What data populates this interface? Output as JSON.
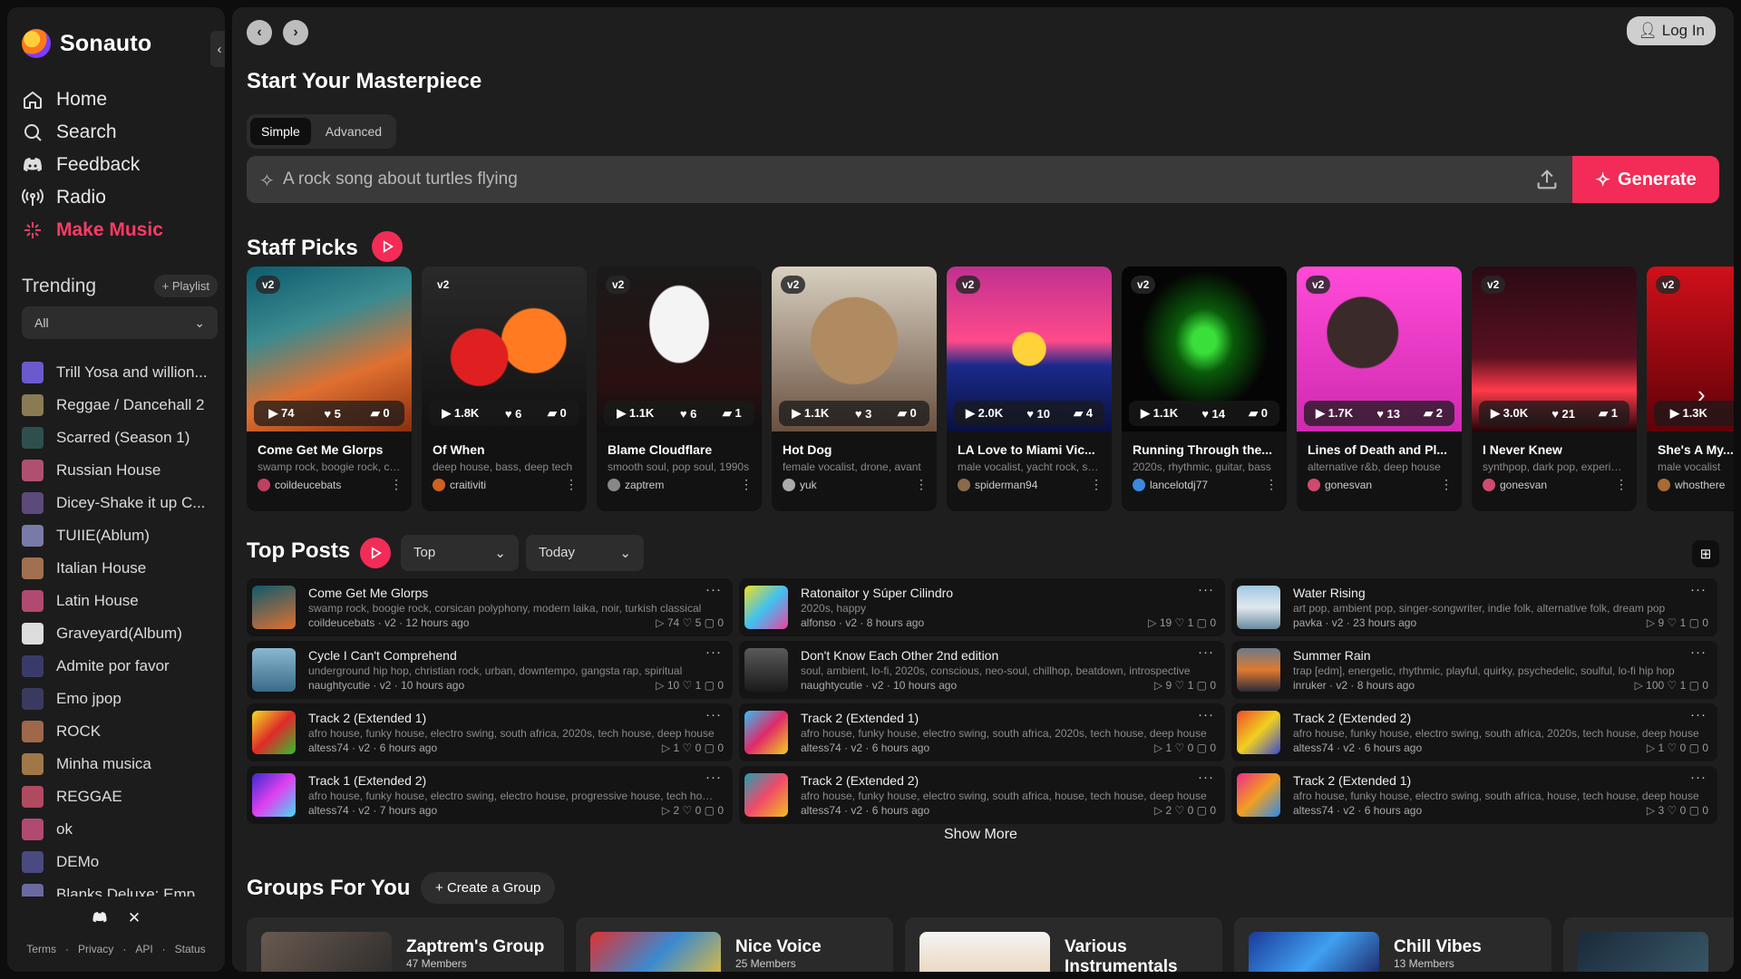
{
  "app": {
    "name": "Sonauto",
    "login_label": "Log In"
  },
  "nav": [
    {
      "label": "Home",
      "icon": "home-icon",
      "active": false
    },
    {
      "label": "Search",
      "icon": "search-icon",
      "active": false
    },
    {
      "label": "Feedback",
      "icon": "discord-icon",
      "active": false
    },
    {
      "label": "Radio",
      "icon": "radio-icon",
      "active": false
    },
    {
      "label": "Make Music",
      "icon": "sparkle-icon",
      "active": true
    }
  ],
  "trending": {
    "title": "Trending",
    "playlist_label": "Playlist",
    "filter_value": "All",
    "items": [
      {
        "label": "Trill Yosa and willion...",
        "color": "#6a5acd"
      },
      {
        "label": "Reggae / Dancehall 2",
        "color": "#8b7b55"
      },
      {
        "label": "Scarred (Season 1)",
        "color": "#2f4f4f"
      },
      {
        "label": "Russian House",
        "color": "#b05070"
      },
      {
        "label": "Dicey-Shake it up C...",
        "color": "#5b4a7a"
      },
      {
        "label": "TUIIE(Ablum)",
        "color": "#7a7aa8"
      },
      {
        "label": "Italian House",
        "color": "#a07050"
      },
      {
        "label": "Latin House",
        "color": "#b04a70"
      },
      {
        "label": "Graveyard(Album)",
        "color": "#dddddd"
      },
      {
        "label": "Admite por favor",
        "color": "#3a3a6a"
      },
      {
        "label": "Emo jpop",
        "color": "#3a3a60"
      },
      {
        "label": "ROCK",
        "color": "#a0684a"
      },
      {
        "label": "Minha musica",
        "color": "#a07848"
      },
      {
        "label": "REGGAE",
        "color": "#b04a60"
      },
      {
        "label": "ok",
        "color": "#b04a70"
      },
      {
        "label": "DEMo",
        "color": "#4a4a80"
      },
      {
        "label": "Blanks Deluxe: Emp",
        "color": "#6a6aa0"
      }
    ]
  },
  "footer": {
    "links": [
      "Terms",
      "Privacy",
      "API",
      "Status"
    ],
    "social": [
      "discord-icon",
      "x-icon"
    ]
  },
  "create": {
    "title": "Start Your Masterpiece",
    "tabs": [
      "Simple",
      "Advanced"
    ],
    "active_tab": "Simple",
    "placeholder": "A rock song about turtles flying",
    "generate_label": "Generate"
  },
  "staff_picks": {
    "title": "Staff Picks",
    "badge": "v2",
    "cards": [
      {
        "title": "Come Get Me Glorps",
        "tags": "swamp rock, boogie rock, corsican polyphony",
        "user": "coildeucebats",
        "plays": "74",
        "likes": "5",
        "comments": "0",
        "art": "linear-gradient(160deg,#0e5b6e 0%,#3a8a8f 35%,#e07030 65%,#8a2e10 100%)",
        "avatar": "#c04060"
      },
      {
        "title": "Of When",
        "tags": "deep house, bass, deep tech",
        "user": "craitiviti",
        "plays": "1.8K",
        "likes": "6",
        "comments": "0",
        "art": "radial-gradient(circle at 35% 55%,#e02020 0 20%,transparent 21%),radial-gradient(circle at 68% 45%,#ff7a20 0 22%,transparent 23%),linear-gradient(180deg,#2a2a2a,#111)",
        "avatar": "#d06020"
      },
      {
        "title": "Blame Cloudflare",
        "tags": "smooth soul, pop soul, 1990s",
        "user": "zaptrem",
        "plays": "1.1K",
        "likes": "6",
        "comments": "1",
        "art": "radial-gradient(ellipse at 50% 35%,#f4f4f4 0 25%,transparent 26%),linear-gradient(180deg,#1a1a1a,#2a1010 70%,#101010)",
        "avatar": "#888888"
      },
      {
        "title": "Hot Dog",
        "tags": "female vocalist, drone, avant",
        "user": "yuk",
        "plays": "1.1K",
        "likes": "3",
        "comments": "0",
        "art": "radial-gradient(circle at 50% 45%,#b08a60 0 35%,transparent 36%),linear-gradient(180deg,#d8d0c0,#6a5040)",
        "avatar": "#aaaaaa"
      },
      {
        "title": "LA Love to Miami Vic...",
        "tags": "male vocalist, yacht rock, synth",
        "user": "spiderman94",
        "plays": "2.0K",
        "likes": "10",
        "comments": "4",
        "art": "radial-gradient(circle at 50% 50%,#ffd23a 0 14%,transparent 15%),linear-gradient(180deg,#c03090 0%,#ff4a8a 45%,#1a2a8a 60%,#0a1040 100%)",
        "avatar": "#8a6a4a"
      },
      {
        "title": "Running Through the...",
        "tags": "2020s, rhythmic, guitar, bass",
        "user": "lancelotdj77",
        "plays": "1.1K",
        "likes": "14",
        "comments": "0",
        "art": "radial-gradient(ellipse at 50% 45%,#3adf3a 0 10%,#0a5a0a 25%,#050505 55%)",
        "avatar": "#3a8adf"
      },
      {
        "title": "Lines of Death and Pl...",
        "tags": "alternative r&b, deep house",
        "user": "gonesvan",
        "plays": "1.7K",
        "likes": "13",
        "comments": "2",
        "art": "radial-gradient(circle at 40% 40%,#3a2a2a 0 25%,transparent 26%),linear-gradient(180deg,#ff4ad8,#d02ab0)",
        "avatar": "#d04a70"
      },
      {
        "title": "I Never Knew",
        "tags": "synthpop, dark pop, experimental",
        "user": "gonesvan",
        "plays": "3.0K",
        "likes": "21",
        "comments": "1",
        "art": "linear-gradient(180deg,#2a0a14 0%,#5a1020 55%,#ff3a4a 75%,#200408 100%)",
        "avatar": "#d04a70"
      },
      {
        "title": "She's A My...",
        "tags": "male vocalist",
        "user": "whosthere",
        "plays": "1.3K",
        "likes": "",
        "comments": "",
        "art": "linear-gradient(180deg,#d0101a,#600008)",
        "avatar": "#aa6a30"
      }
    ]
  },
  "top_posts": {
    "title": "Top Posts",
    "sort_value": "Top",
    "range_value": "Today",
    "show_more_label": "Show More",
    "posts": [
      {
        "title": "Come Get Me Glorps",
        "tags": "swamp rock, boogie rock, corsican polyphony, modern laika, noir, turkish classical",
        "user": "coildeucebats",
        "version": "v2",
        "time": "12 hours ago",
        "plays": "74",
        "likes": "5",
        "comments": "0",
        "art": "linear-gradient(160deg,#0e5b6e,#e07030)"
      },
      {
        "title": "Ratonaitor y Súper Cilindro",
        "tags": "2020s, happy",
        "user": "alfonso",
        "version": "v2",
        "time": "8 hours ago",
        "plays": "19",
        "likes": "1",
        "comments": "0",
        "art": "linear-gradient(135deg,#f0e020,#40c0f0,#f040a0)"
      },
      {
        "title": "Water Rising",
        "tags": "art pop, ambient pop, singer-songwriter, indie folk, alternative folk, dream pop",
        "user": "pavka",
        "version": "v2",
        "time": "23 hours ago",
        "plays": "9",
        "likes": "1",
        "comments": "0",
        "art": "linear-gradient(180deg,#a0c8e0,#e0e8f0,#6a8aa0)"
      },
      {
        "title": "Cycle I Can't Comprehend",
        "tags": "underground hip hop, christian rock, urban, downtempo, gangsta rap, spiritual",
        "user": "naughtycutie",
        "version": "v2",
        "time": "10 hours ago",
        "plays": "10",
        "likes": "1",
        "comments": "0",
        "art": "linear-gradient(180deg,#8ab8d0,#3a6a8a)"
      },
      {
        "title": "Don't Know Each Other 2nd edition",
        "tags": "soul, ambient, lo-fi, 2020s, conscious, neo-soul, chillhop, beatdown, introspective",
        "user": "naughtycutie",
        "version": "v2",
        "time": "10 hours ago",
        "plays": "9",
        "likes": "1",
        "comments": "0",
        "art": "linear-gradient(180deg,#5a5a5a,#1a1a1a)"
      },
      {
        "title": "Summer Rain",
        "tags": "trap [edm], energetic, rhythmic, playful, quirky, psychedelic, soulful, lo-fi hip hop",
        "user": "inruker",
        "version": "v2",
        "time": "8 hours ago",
        "plays": "100",
        "likes": "1",
        "comments": "0",
        "art": "linear-gradient(180deg,#6a7a8a,#e07a30,#2a2a3a)"
      },
      {
        "title": "Track 2 (Extended 1)",
        "tags": "afro house, funky house, electro swing, south africa, 2020s, tech house, deep house",
        "user": "altess74",
        "version": "v2",
        "time": "6 hours ago",
        "plays": "1",
        "likes": "0",
        "comments": "0",
        "art": "linear-gradient(135deg,#f0e020,#e02a2a,#30c030)"
      },
      {
        "title": "Track 2 (Extended 1)",
        "tags": "afro house, funky house, electro swing, south africa, 2020s, tech house, deep house",
        "user": "altess74",
        "version": "v2",
        "time": "6 hours ago",
        "plays": "1",
        "likes": "0",
        "comments": "0",
        "art": "linear-gradient(135deg,#30c0f0,#e02a6a,#f0d020)"
      },
      {
        "title": "Track 2 (Extended 2)",
        "tags": "afro house, funky house, electro swing, south africa, 2020s, tech house, deep house",
        "user": "altess74",
        "version": "v2",
        "time": "6 hours ago",
        "plays": "1",
        "likes": "0",
        "comments": "0",
        "art": "linear-gradient(135deg,#f04a2a,#f0d020,#3a4ad0)"
      },
      {
        "title": "Track 1 (Extended 2)",
        "tags": "afro house, funky house, electro swing, electro house, progressive house, tech house",
        "user": "altess74",
        "version": "v2",
        "time": "7 hours ago",
        "plays": "2",
        "likes": "0",
        "comments": "0",
        "art": "linear-gradient(135deg,#3a2ad0,#e040f0,#40e0f0)"
      },
      {
        "title": "Track 2 (Extended 2)",
        "tags": "afro house, funky house, electro swing, south africa, house, tech house, deep house",
        "user": "altess74",
        "version": "v2",
        "time": "6 hours ago",
        "plays": "2",
        "likes": "0",
        "comments": "0",
        "art": "linear-gradient(135deg,#20a0b0,#f04a6a,#f0c020)"
      },
      {
        "title": "Track 2 (Extended 1)",
        "tags": "afro house, funky house, electro swing, south africa, house, tech house, deep house",
        "user": "altess74",
        "version": "v2",
        "time": "6 hours ago",
        "plays": "3",
        "likes": "0",
        "comments": "0",
        "art": "linear-gradient(135deg,#f02a8a,#f0a020,#2a8af0)"
      }
    ]
  },
  "groups": {
    "title": "Groups For You",
    "create_label": "Create a Group",
    "items": [
      {
        "name": "Zaptrem's Group",
        "members": "47 Members",
        "art": "linear-gradient(135deg,#6a5a50,#2a2a2a)"
      },
      {
        "name": "Nice Voice",
        "members": "25 Members",
        "art": "linear-gradient(135deg,#e03030,#3a8ad0,#f0c030)"
      },
      {
        "name": "Various Instrumentals",
        "members": "",
        "art": "linear-gradient(180deg,#f4f4f4,#e8d0b0)"
      },
      {
        "name": "Chill Vibes",
        "members": "13 Members",
        "art": "linear-gradient(135deg,#1a3a9a,#40a0f0,#1a1a5a)"
      },
      {
        "name": "",
        "members": "",
        "art": "linear-gradient(135deg,#1a2a3a,#3a5a6a)"
      }
    ]
  },
  "colors": {
    "accent": "#f22c57",
    "sidebar": "#1c1c1c",
    "main": "#1e1e1e"
  }
}
